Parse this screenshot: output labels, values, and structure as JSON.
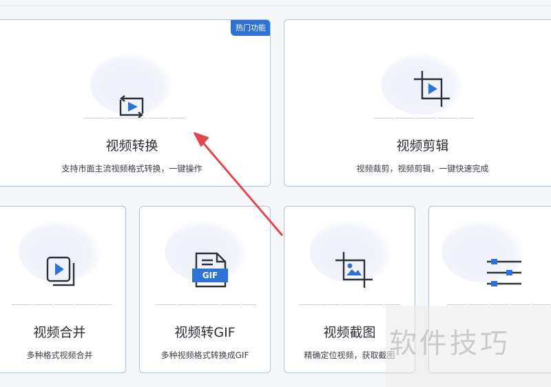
{
  "colors": {
    "accent": "#2f72d6",
    "arrow": "#e0474c",
    "border": "#aac3df"
  },
  "badge": {
    "label": "热门功能"
  },
  "cards": [
    {
      "title": "视频转换",
      "desc": "支持市面主流视频格式转换，一键操作",
      "icon": "video-convert-icon"
    },
    {
      "title": "视频剪辑",
      "desc": "视频裁剪，视频剪辑，一键快速完成",
      "icon": "crop-play-icon"
    },
    {
      "title": "视频合并",
      "desc": "多种格式视频合并",
      "icon": "video-merge-icon"
    },
    {
      "title": "视频转GIF",
      "desc": "多种视频格式转换成GIF",
      "icon": "gif-file-icon",
      "gif_label": "GIF"
    },
    {
      "title": "视频截图",
      "desc": "精确定位视频，获取截图",
      "icon": "crop-image-icon"
    },
    {
      "title": "",
      "desc": "",
      "icon": "sliders-icon"
    }
  ],
  "watermark": "软件技巧"
}
